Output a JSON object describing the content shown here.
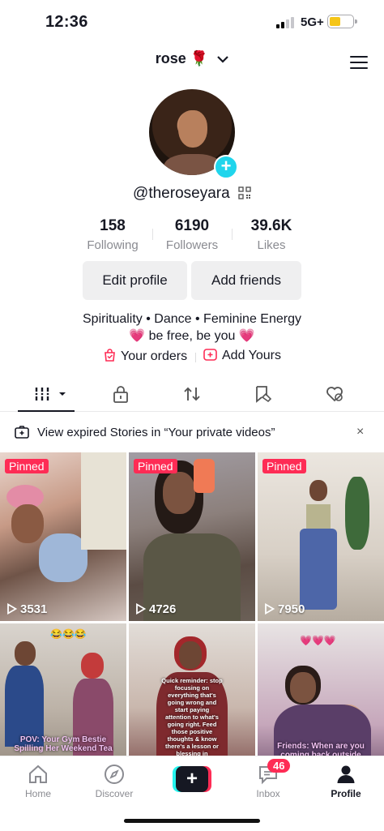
{
  "status_bar": {
    "time": "12:36",
    "network": "5G+"
  },
  "header": {
    "title": "rose",
    "title_emoji": "🌹"
  },
  "profile": {
    "handle": "@theroseyara",
    "stats": [
      {
        "value": "158",
        "label": "Following"
      },
      {
        "value": "6190",
        "label": "Followers"
      },
      {
        "value": "39.6K",
        "label": "Likes"
      }
    ],
    "edit_label": "Edit profile",
    "add_friends_label": "Add friends",
    "bio_line1": "Spirituality • Dance • Feminine Energy",
    "bio_line2_left": "💗",
    "bio_line2_text": "be free, be you",
    "bio_line2_right": "💗",
    "links": {
      "orders": "Your orders",
      "add_yours": "Add Yours"
    }
  },
  "notice": {
    "text": "View expired Stories in “Your private videos”",
    "close": "×"
  },
  "videos": [
    {
      "pinned": "Pinned",
      "views": "3531"
    },
    {
      "pinned": "Pinned",
      "views": "4726"
    },
    {
      "pinned": "Pinned",
      "views": "7950"
    },
    {
      "caption": "POV: Your Gym Bestie Spilling Her Weekend Tea",
      "emoji": "😂😂😂"
    },
    {
      "caption": "Quick reminder: stop focusing on everything that's going wrong and start paying attention to what's going right. Feed those positive thoughts & know there's a lesson or blessing in everything."
    },
    {
      "caption": "Friends: When are you coming back outside",
      "emoji": "💗💗💗"
    }
  ],
  "bottom_nav": {
    "home": "Home",
    "discover": "Discover",
    "create": "+",
    "inbox": "Inbox",
    "inbox_badge": "46",
    "profile": "Profile"
  },
  "colors": {
    "accent": "#fe2c55",
    "cyan": "#25f4ee",
    "avatar_plus": "#20d5ec",
    "battery": "#f5c518"
  }
}
